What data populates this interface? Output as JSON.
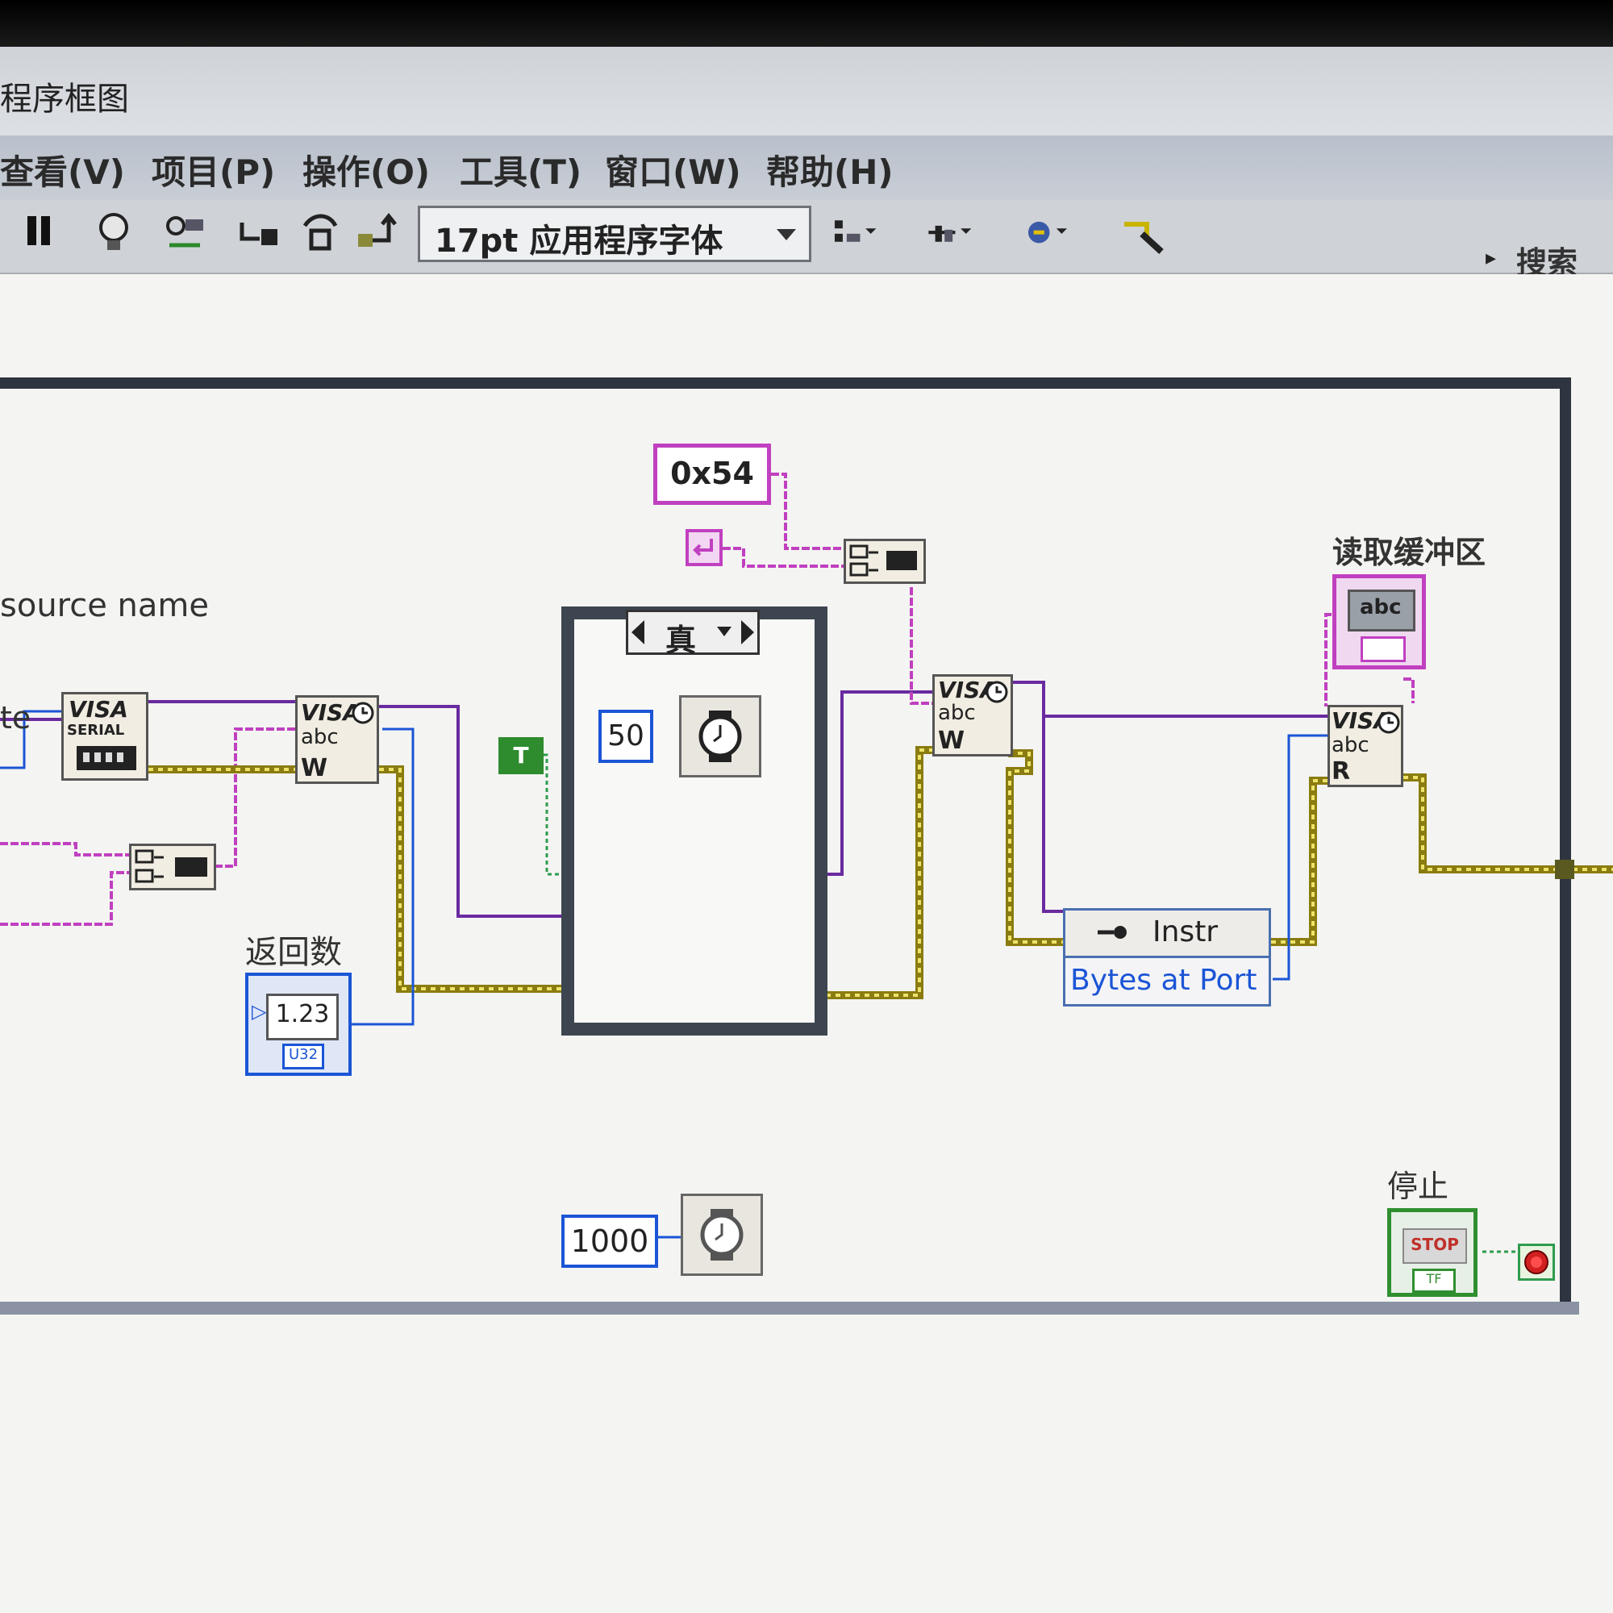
{
  "window": {
    "title": "程序框图"
  },
  "menu": [
    {
      "label": "查看(V)"
    },
    {
      "label": "项目(P)"
    },
    {
      "label": "操作(O)"
    },
    {
      "label": "工具(T)"
    },
    {
      "label": "窗口(W)"
    },
    {
      "label": "帮助(H)"
    }
  ],
  "toolbar": {
    "font": "17pt 应用程序字体",
    "search": "搜索"
  },
  "diagram": {
    "resource_label": "source name",
    "resource_fragment": "te",
    "hex_const": "0x54",
    "read_buffer_label": "读取缓冲区",
    "return_count_label": "返回数",
    "return_count_value": "1.23",
    "return_count_type": "U32",
    "case_selector": "真",
    "true_const": "T",
    "wait_inner": "50",
    "wait_outer": "1000",
    "property_class": "Instr",
    "property_name": "Bytes at Port",
    "stop_label": "停止",
    "stop_button": "STOP",
    "stop_type": "TF",
    "visa_serial_title": "VISA",
    "visa_serial_sub": "SERIAL",
    "visa_title": "VISA",
    "visa_abc": "abc",
    "visa_write_mode": "W",
    "visa_read_mode": "R",
    "indicator_abc": "abc"
  },
  "colors": {
    "string_wire": "#c040c0",
    "visa_wire": "#6a2aa0",
    "error_wire": "#c8b400",
    "numeric_wire": "#1b55d6",
    "bool_wire": "#2e9b4e"
  }
}
